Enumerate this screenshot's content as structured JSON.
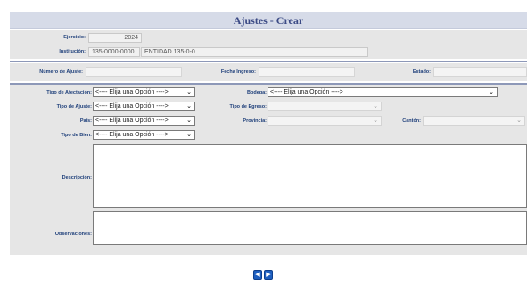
{
  "page": {
    "title": "Ajustes - Crear"
  },
  "header": {
    "ejercicio_label": "Ejercicio:",
    "ejercicio_value": "2024",
    "institucion_label": "Institución:",
    "institucion_code": "135-0000-0000",
    "institucion_name": "ENTIDAD 135-0-0"
  },
  "info": {
    "numero_label": "Número de Ajuste:",
    "fecha_label": "Fecha Ingreso:",
    "estado_label": "Estado:"
  },
  "form": {
    "tipo_afectacion_label": "Tipo de Afectación:",
    "tipo_afectacion_value": "<---- Elija una Opción ---->",
    "bodega_label": "Bodega:",
    "bodega_value": "<---- Elija una Opción ---->",
    "tipo_ajuste_label": "Tipo de Ajuste:",
    "tipo_ajuste_value": "<---- Elija una Opción ---->",
    "tipo_egreso_label": "Tipo de Egreso:",
    "pais_label": "País:",
    "pais_value": "<---- Elija una Opción ---->",
    "provincia_label": "Provincia:",
    "canton_label": "Cantón:",
    "tipo_bien_label": "Tipo de Bien:",
    "tipo_bien_value": "<---- Elija una Opción ---->",
    "descripcion_label": "Descripción:",
    "observaciones_label": "Observaciones:"
  },
  "icons": {
    "prev": "back-arrow-icon",
    "next": "forward-arrow-icon",
    "accent": "#1f5fbf"
  }
}
